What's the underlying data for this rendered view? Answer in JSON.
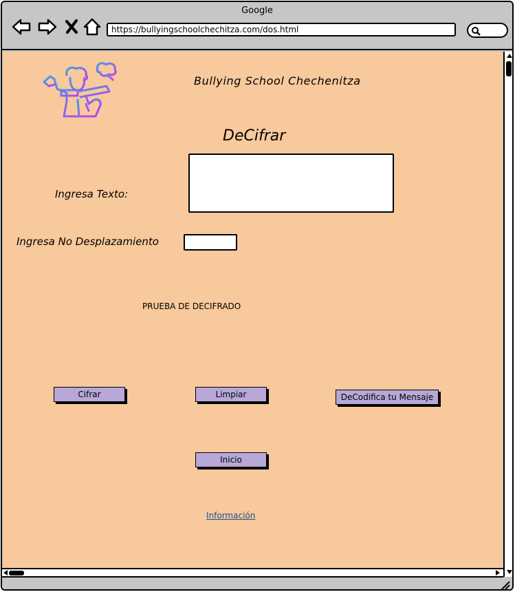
{
  "window": {
    "title": "Google"
  },
  "browser": {
    "url": "https://bullyingschoolchechitza.com/dos.html",
    "nav_icons": [
      "back-arrow-icon",
      "forward-arrow-icon",
      "close-x-icon",
      "home-icon"
    ],
    "search_icon": "search-icon"
  },
  "page": {
    "site_title": "Bullying School Chechenitza",
    "heading": "DeCifrar",
    "text_label": "Ingresa Texto:",
    "text_value": "",
    "shift_label": "Ingresa No Desplazamiento",
    "shift_value": "",
    "result": "PRUEBA DE DECIFRADO",
    "buttons": {
      "cifrar": "Cifrar",
      "limpiar": "Limpiar",
      "decodifica": "DeCodifica tu Mensaje",
      "inicio": "Inicio"
    },
    "info_link": "Información"
  },
  "colors": {
    "background": "#f8c99c",
    "button": "#b7a8d8",
    "link": "#1a4f8a",
    "logo_gradient": [
      "#3aa0e8",
      "#c23ef0"
    ]
  }
}
